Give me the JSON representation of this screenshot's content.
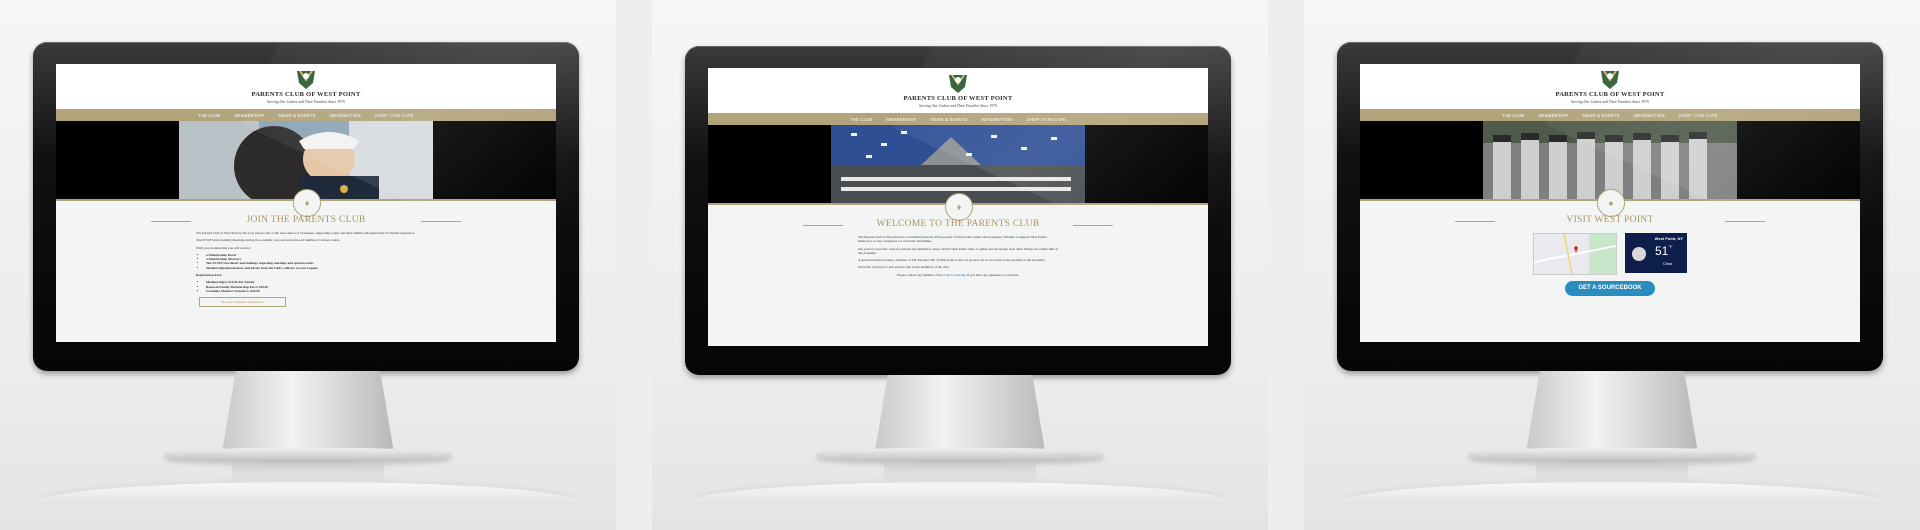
{
  "site": {
    "title": "PARENTS CLUB OF WEST POINT",
    "tagline": "Serving Our Cadets and Their Families Since 1976"
  },
  "nav": [
    "THE CLUB",
    "MEMBERSHIP",
    "NEWS & EVENTS",
    "INFORMATION",
    "SHOP / FUN CAFE"
  ],
  "panels": [
    {
      "heading": "JOIN THE PARENTS CLUB",
      "paragraphs": [
        "The Parents Club of West Point is the local parent club of the Association of Graduates, supporting cadets and their families throughout the 47-month experience.",
        "The PCWP holds monthly meetings during the academic year and welcomes all families of current cadets."
      ],
      "intro": "With your membership you will receive:",
      "benefits": [
        "a Membership Decal",
        "a Membership directory",
        "The PCWP Newsletter and mailings regarding meetings and special events",
        "Membership information, and advice from the Club's officers at your request"
      ],
      "fees_heading": "Registration Fees:",
      "fees": [
        "Membership is $75.00 Per Family",
        "Renewal Family Membership Fee is $50.00",
        "Graduate Member Transfer is $40.00"
      ],
      "button": "Proceed to Member Registration"
    },
    {
      "heading": "WELCOME TO THE PARENTS CLUB",
      "paragraphs": [
        "The Parents Club of West Point is a wonderful network of the parents of West Point Cadets and Graduates. Whether to support West Point's mission or to stay connected, we welcome all families.",
        "Our goal is to provide ways for parents and families to enjoy all that West Point offers, to guide and encourage each other during our cadets' time at the Academy.",
        "A special benefit of being a member of The Parents Club of West Point is that we sponsor all of our events at the grounds of the Academy.",
        "We invite everyone to join and become active members of the club."
      ],
      "contact_pre": "Please contact any member of the",
      "contact_link": "Club Leadership",
      "contact_post": "if you have any questions or concerns."
    },
    {
      "heading": "VISIT WEST POINT",
      "weather": {
        "location": "West Point, NY",
        "temp": "51",
        "unit": "°F",
        "condition": "Clear"
      },
      "button": "GET A SOURCEBOOK"
    }
  ],
  "colors": {
    "gold": "#b1a37a",
    "heading_gold": "#a99462",
    "button_blue": "#2a8dbf"
  }
}
